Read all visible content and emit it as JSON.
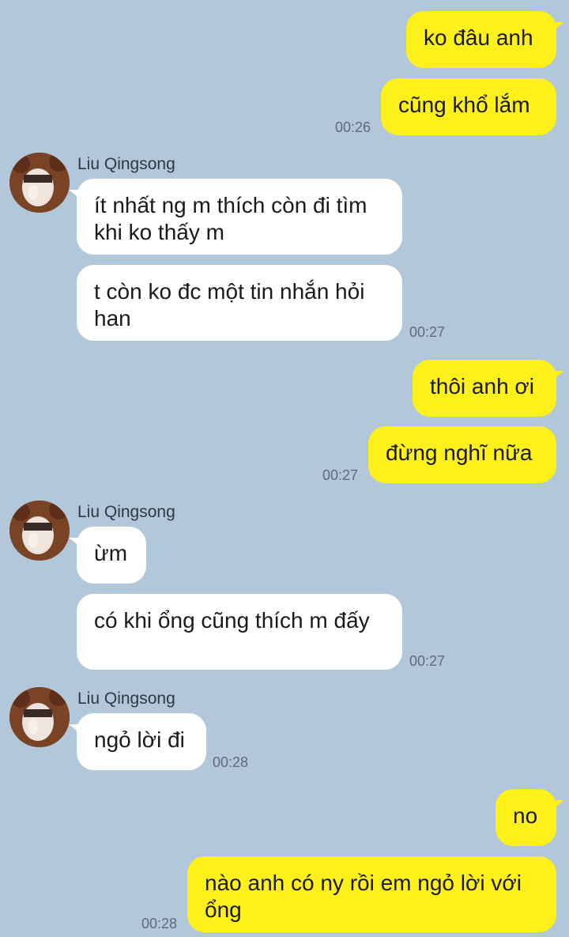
{
  "colors": {
    "background": "#b2c7d9",
    "my_bubble": "#fef01b",
    "their_bubble": "#ffffff"
  },
  "contact": {
    "name": "Liu Qingsong",
    "avatar_icon": "profile-photo-bear-hood"
  },
  "messages": [
    {
      "from": "me",
      "text": "ko đâu anh"
    },
    {
      "from": "me",
      "text": "cũng khổ lắm",
      "time": "00:26"
    },
    {
      "from": "them",
      "sender": "Liu Qingsong",
      "text": "ít nhất ng m thích còn đi tìm khi ko thấy m"
    },
    {
      "from": "them",
      "text": "t còn ko đc một tin nhắn hỏi han",
      "time": "00:27"
    },
    {
      "from": "me",
      "text": "thôi anh ơi"
    },
    {
      "from": "me",
      "text": "đừng nghĩ nữa",
      "time": "00:27"
    },
    {
      "from": "them",
      "sender": "Liu Qingsong",
      "text": "ừm"
    },
    {
      "from": "them",
      "text": "có khi ổng cũng thích m đấy",
      "time": "00:27"
    },
    {
      "from": "them",
      "sender": "Liu Qingsong",
      "text": "ngỏ lời đi",
      "time": "00:28"
    },
    {
      "from": "me",
      "text": "no"
    },
    {
      "from": "me",
      "text": "nào anh có ny rồi em ngỏ lời với ổng",
      "time": "00:28"
    }
  ]
}
